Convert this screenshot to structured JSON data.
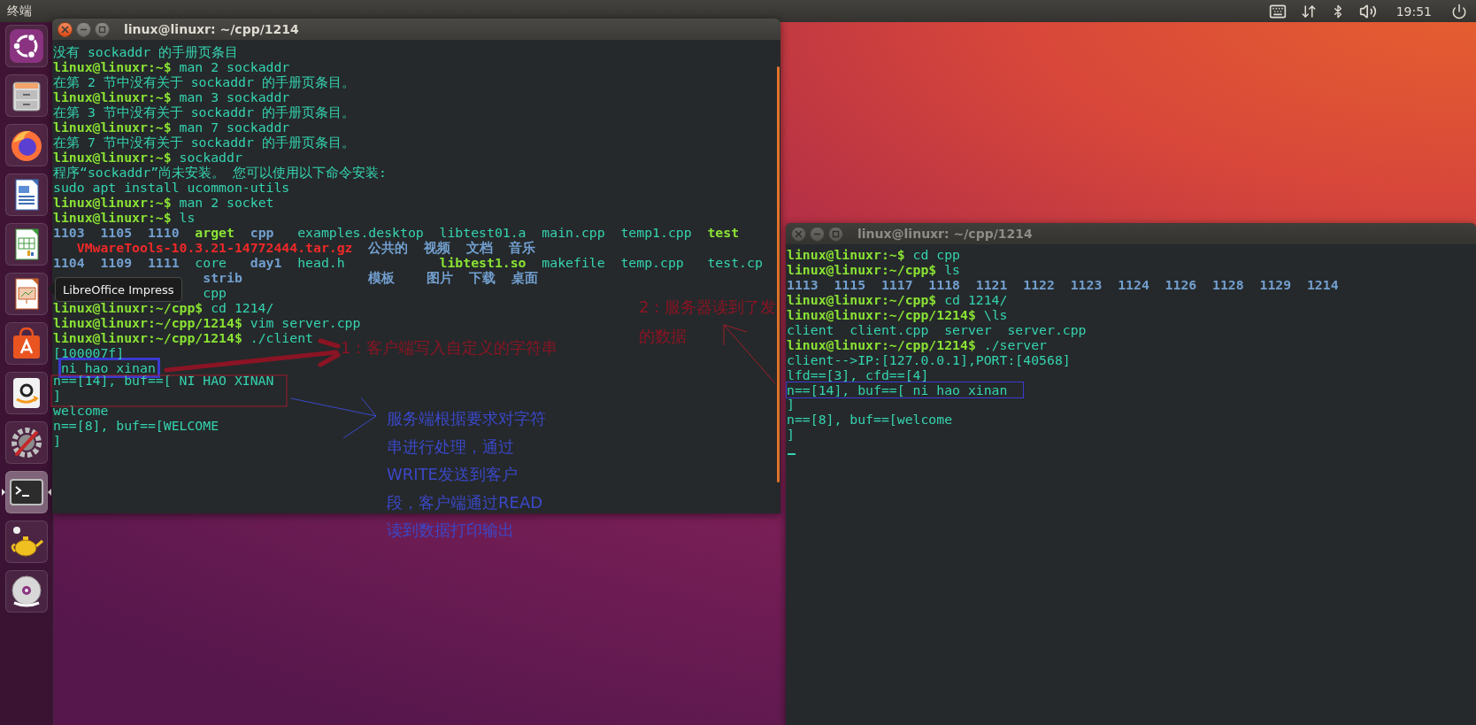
{
  "top_bar": {
    "title": "终端",
    "clock": "19:51"
  },
  "dock": {
    "tooltip": "LibreOffice Impress",
    "items": [
      {
        "kind": "ubuntu",
        "active": false
      },
      {
        "kind": "files",
        "active": false
      },
      {
        "kind": "browser",
        "active": false
      },
      {
        "kind": "writer",
        "active": false
      },
      {
        "kind": "calc",
        "active": false
      },
      {
        "kind": "impress",
        "active": false
      },
      {
        "kind": "store",
        "active": false
      },
      {
        "kind": "amazon",
        "active": false
      },
      {
        "kind": "settings",
        "active": false
      },
      {
        "kind": "terminal",
        "active": true
      },
      {
        "kind": "teapot",
        "active": false
      },
      {
        "kind": "dvd",
        "active": false
      }
    ]
  },
  "windows": [
    {
      "title": "linux@linuxr: ~/cpp/1214",
      "focused": true,
      "lines": [
        {
          "segments": [
            {
              "text": "没有 sockaddr 的手册页条目",
              "kind": "plain"
            }
          ]
        },
        {
          "segments": [
            {
              "text": "linux@linuxr:~$",
              "kind": "prompt"
            },
            {
              "text": " man 2 sockaddr",
              "kind": "plain"
            }
          ]
        },
        {
          "segments": [
            {
              "text": "在第 2 节中没有关于 sockaddr 的手册页条目。",
              "kind": "plain"
            }
          ]
        },
        {
          "segments": [
            {
              "text": "linux@linuxr:~$",
              "kind": "prompt"
            },
            {
              "text": " man 3 sockaddr",
              "kind": "plain"
            }
          ]
        },
        {
          "segments": [
            {
              "text": "在第 3 节中没有关于 sockaddr 的手册页条目。",
              "kind": "plain"
            }
          ]
        },
        {
          "segments": [
            {
              "text": "linux@linuxr:~$",
              "kind": "prompt"
            },
            {
              "text": " man 7 sockaddr",
              "kind": "plain"
            }
          ]
        },
        {
          "segments": [
            {
              "text": "在第 7 节中没有关于 sockaddr 的手册页条目。",
              "kind": "plain"
            }
          ]
        },
        {
          "segments": [
            {
              "text": "linux@linuxr:~$",
              "kind": "prompt"
            },
            {
              "text": " sockaddr",
              "kind": "plain"
            }
          ]
        },
        {
          "segments": [
            {
              "text": "程序“sockaddr”尚未安装。 您可以使用以下命令安装:",
              "kind": "plain"
            }
          ]
        },
        {
          "segments": [
            {
              "text": "sudo apt install ucommon-utils",
              "kind": "plain"
            }
          ]
        },
        {
          "segments": [
            {
              "text": "linux@linuxr:~$",
              "kind": "prompt"
            },
            {
              "text": " man 2 socket",
              "kind": "plain"
            }
          ]
        },
        {
          "segments": [
            {
              "text": "linux@linuxr:~$",
              "kind": "prompt"
            },
            {
              "text": " ls",
              "kind": "plain"
            }
          ]
        },
        {
          "segments": [
            {
              "text": "1103  1105  1110  ",
              "kind": "dir"
            },
            {
              "text": "arget  ",
              "kind": "exec"
            },
            {
              "text": "cpp",
              "kind": "dir"
            },
            {
              "text": "   examples.desktop  libtest01.a  main.cpp  temp1.cpp  ",
              "kind": "plain"
            },
            {
              "text": "test",
              "kind": "exec"
            }
          ]
        },
        {
          "segments": [
            {
              "text": "   VMwareTools-10.3.21-14772444.tar.gz",
              "kind": "archive"
            },
            {
              "text": "  公共的  视频  文档  音乐",
              "kind": "dir"
            }
          ]
        },
        {
          "segments": [
            {
              "text": "1104  1109  1111  ",
              "kind": "dir"
            },
            {
              "text": "core   ",
              "kind": "plain"
            },
            {
              "text": "day1",
              "kind": "dir"
            },
            {
              "text": "  head.h            ",
              "kind": "plain"
            },
            {
              "text": "libtest1.so",
              "kind": "exec"
            },
            {
              "text": "  makefile  temp.cpp   test.cp",
              "kind": "plain"
            }
          ]
        },
        {
          "segments": [
            {
              "text": "                   strib                模板    图片  下载  桌面",
              "kind": "dir"
            }
          ]
        },
        {
          "segments": [
            {
              "text": "                   cpp",
              "kind": "plain"
            }
          ]
        },
        {
          "segments": [
            {
              "text": "linux@linuxr:~/cpp$",
              "kind": "prompt"
            },
            {
              "text": " cd 1214/",
              "kind": "plain"
            }
          ]
        },
        {
          "segments": [
            {
              "text": "linux@linuxr:~/cpp/1214$",
              "kind": "prompt"
            },
            {
              "text": " vim server.cpp",
              "kind": "plain"
            }
          ]
        },
        {
          "segments": [
            {
              "text": "linux@linuxr:~/cpp/1214$",
              "kind": "prompt"
            },
            {
              "text": " ./client",
              "kind": "plain"
            }
          ]
        },
        {
          "segments": [
            {
              "text": "[100007f]",
              "kind": "plain"
            }
          ]
        },
        {
          "kind": "highlight",
          "segments": [
            {
              "text": " ni hao xinan",
              "kind": "plain"
            }
          ]
        },
        {
          "segments": [
            {
              "text": "n==[14], buf==[ NI HAO XINAN",
              "kind": "plain"
            }
          ]
        },
        {
          "segments": [
            {
              "text": "]",
              "kind": "plain"
            }
          ]
        },
        {
          "segments": [
            {
              "text": "welcome",
              "kind": "plain"
            }
          ]
        },
        {
          "segments": [
            {
              "text": "n==[8], buf==[WELCOME",
              "kind": "plain"
            }
          ]
        },
        {
          "segments": [
            {
              "text": "]",
              "kind": "plain"
            }
          ]
        }
      ]
    },
    {
      "title": "linux@linuxr: ~/cpp/1214",
      "focused": false,
      "cursor": true,
      "lines": [
        {
          "segments": [
            {
              "text": "linux@linuxr:~$",
              "kind": "prompt"
            },
            {
              "text": " cd cpp",
              "kind": "plain"
            }
          ]
        },
        {
          "segments": [
            {
              "text": "linux@linuxr:~/cpp$",
              "kind": "prompt"
            },
            {
              "text": " ls",
              "kind": "plain"
            }
          ]
        },
        {
          "segments": [
            {
              "text": "1113  1115  1117  1118  1121  1122  1123  1124  1126  1128  1129  1214",
              "kind": "dir"
            }
          ]
        },
        {
          "segments": [
            {
              "text": "linux@linuxr:~/cpp$",
              "kind": "prompt"
            },
            {
              "text": " cd 1214/",
              "kind": "plain"
            }
          ]
        },
        {
          "segments": [
            {
              "text": "linux@linuxr:~/cpp/1214$",
              "kind": "prompt"
            },
            {
              "text": " \\ls",
              "kind": "plain"
            }
          ]
        },
        {
          "segments": [
            {
              "text": "client  client.cpp  server  server.cpp",
              "kind": "plain"
            }
          ]
        },
        {
          "segments": [
            {
              "text": "linux@linuxr:~/cpp/1214$",
              "kind": "prompt"
            },
            {
              "text": " ./server",
              "kind": "plain"
            }
          ]
        },
        {
          "segments": [
            {
              "text": "client-->IP:[127.0.0.1],PORT:[40568]",
              "kind": "plain"
            }
          ]
        },
        {
          "segments": [
            {
              "text": "lfd==[3], cfd==[4]",
              "kind": "plain"
            }
          ]
        },
        {
          "kind": "outline",
          "segments": [
            {
              "text": "n==[14], buf==[ ni hao xinan",
              "kind": "plain"
            }
          ]
        },
        {
          "segments": [
            {
              "text": "]",
              "kind": "plain"
            }
          ]
        },
        {
          "segments": [
            {
              "text": "n==[8], buf==[welcome",
              "kind": "plain"
            }
          ]
        },
        {
          "segments": [
            {
              "text": "]",
              "kind": "plain"
            }
          ]
        }
      ]
    }
  ],
  "notes": [
    {
      "color": "#8b1424",
      "lines": [
        "1：客户端写入自定义的字符串"
      ]
    },
    {
      "color": "#3b48c8",
      "lines": [
        "服务端根据要求对字符",
        "串进行处理，通过",
        "WRITE发送到客户",
        "段，客户端通过READ",
        "读到数据打印输出"
      ]
    },
    {
      "color": "#8b1424",
      "lines": [
        "2：服务器读到了发",
        "的数据"
      ]
    }
  ]
}
